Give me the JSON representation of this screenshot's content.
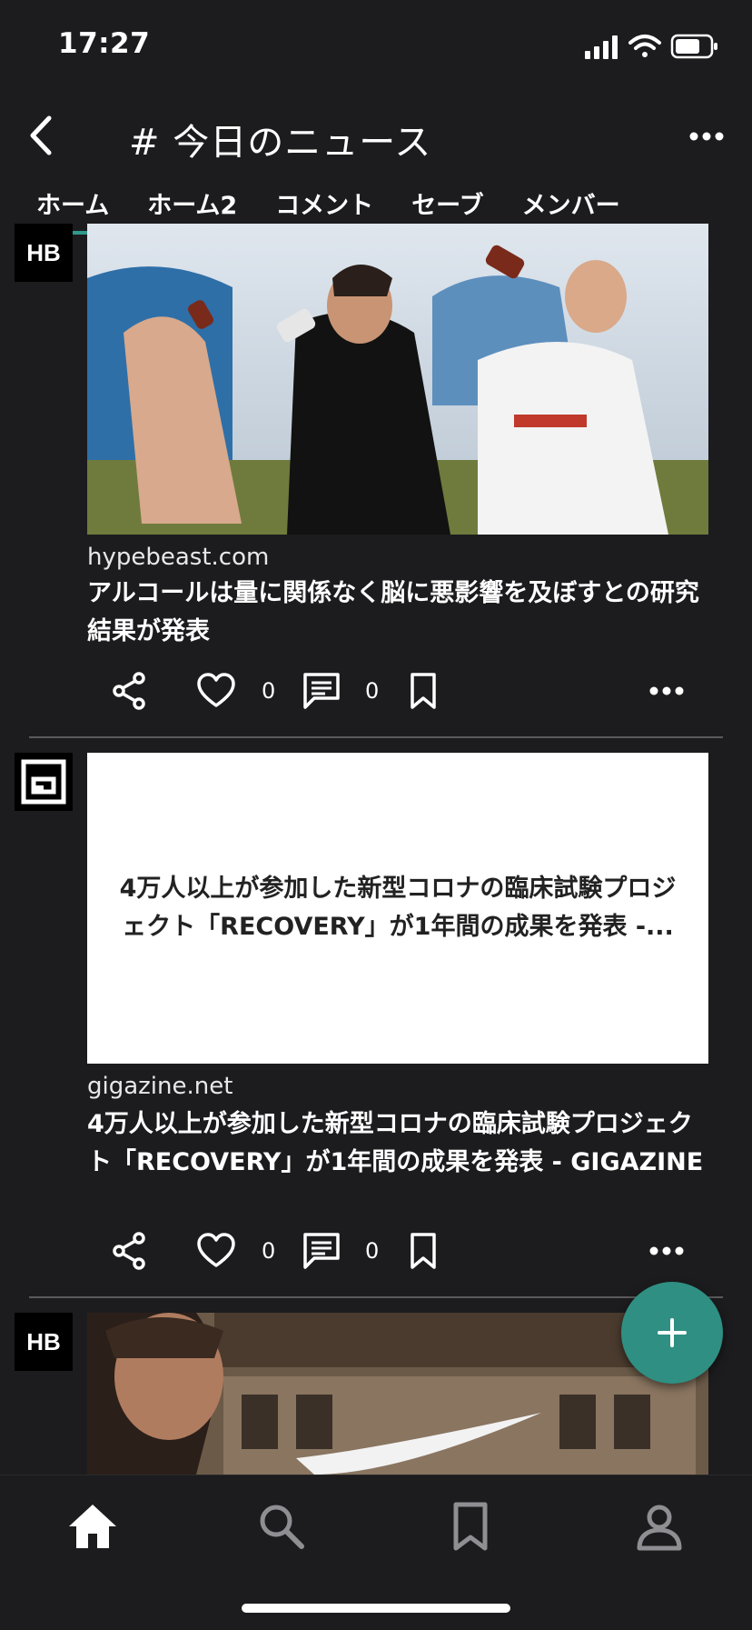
{
  "status": {
    "time": "17:27"
  },
  "header": {
    "title": "# 今日のニュース"
  },
  "tabs": [
    {
      "label": "ホーム",
      "active": true
    },
    {
      "label": "ホーム2",
      "active": false
    },
    {
      "label": "コメント",
      "active": false
    },
    {
      "label": "セーブ",
      "active": false
    },
    {
      "label": "メンバー",
      "active": false
    }
  ],
  "posts": [
    {
      "avatar": "HB",
      "domain": "hypebeast.com",
      "title": "アルコールは量に関係なく脳に悪影響を及ぼすとの研究結果が発表",
      "likes": "0",
      "comments": "0"
    },
    {
      "avatar_icon": "gigazine-logo-icon",
      "preview_text": "4万人以上が参加した新型コロナの臨床試験プロジェクト「RECOVERY」が1年間の成果を発表 -...",
      "domain": "gigazine.net",
      "title": "4万人以上が参加した新型コロナの臨床試験プロジェクト「RECOVERY」が1年間の成果を発表 - GIGAZINE",
      "likes": "0",
      "comments": "0"
    },
    {
      "avatar": "HB"
    }
  ],
  "colors": {
    "accent": "#2f9a8c",
    "fab": "#2f8f82",
    "background": "#1c1c1e"
  }
}
